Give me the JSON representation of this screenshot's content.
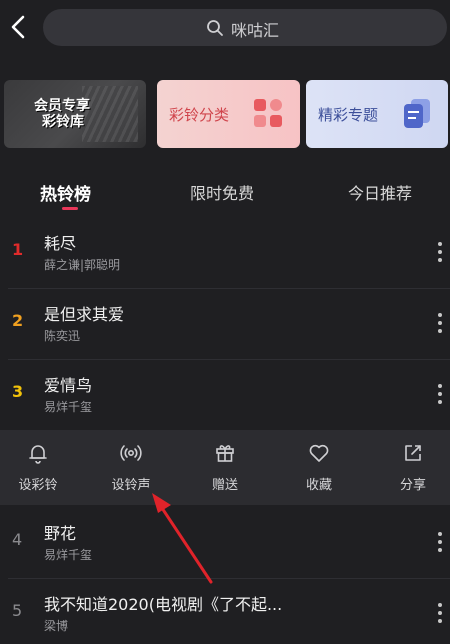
{
  "search": {
    "text": "咪咕汇"
  },
  "banners": [
    {
      "label": "会员专享 彩铃库",
      "line1": "会员专享",
      "line2": "彩铃库"
    },
    {
      "label": "彩铃分类"
    },
    {
      "label": "精彩专题"
    }
  ],
  "tabs": [
    {
      "label": "热铃榜",
      "active": true
    },
    {
      "label": "限时免费",
      "active": false
    },
    {
      "label": "今日推荐",
      "active": false
    }
  ],
  "songs": [
    {
      "rank": "1",
      "title": "耗尽",
      "artist": "薛之谦|郭聪明",
      "rank_color": "#e02b2b"
    },
    {
      "rank": "2",
      "title": "是但求其爱",
      "artist": "陈奕迅",
      "rank_color": "#f0a020"
    },
    {
      "rank": "3",
      "title": "爱情鸟",
      "artist": "易烊千玺",
      "rank_color": "#f2c20a"
    },
    {
      "rank": "4",
      "title": "野花",
      "artist": "易烊千玺",
      "rank_color": "#8a8a8e"
    },
    {
      "rank": "5",
      "title": "我不知道2020(电视剧《了不起...",
      "artist": "梁博",
      "rank_color": "#8a8a8e"
    }
  ],
  "actions": [
    {
      "label": "设彩铃",
      "icon": "bell-icon"
    },
    {
      "label": "设铃声",
      "icon": "broadcast-icon"
    },
    {
      "label": "赠送",
      "icon": "gift-icon"
    },
    {
      "label": "收藏",
      "icon": "heart-icon"
    },
    {
      "label": "分享",
      "icon": "share-icon"
    }
  ],
  "colors": {
    "accent": "#e8375a",
    "annotation_arrow": "#e0232a"
  }
}
